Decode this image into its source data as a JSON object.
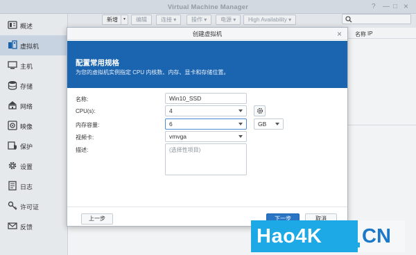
{
  "window": {
    "title": "Virtual Machine Manager",
    "help": "?",
    "minimize": "—",
    "maximize": "□",
    "close": "×"
  },
  "sidebar": {
    "active_index": 1,
    "items": [
      {
        "label": "概述",
        "icon": "overview-icon"
      },
      {
        "label": "虚拟机",
        "icon": "virtual-machine-icon"
      },
      {
        "label": "主机",
        "icon": "host-monitor-icon"
      },
      {
        "label": "存储",
        "icon": "storage-icon"
      },
      {
        "label": "网络",
        "icon": "network-icon"
      },
      {
        "label": "映像",
        "icon": "image-icon"
      },
      {
        "label": "保护",
        "icon": "protection-icon"
      },
      {
        "label": "设置",
        "icon": "settings-gear-icon"
      },
      {
        "label": "日志",
        "icon": "log-icon"
      },
      {
        "label": "许可证",
        "icon": "license-key-icon"
      },
      {
        "label": "反馈",
        "icon": "feedback-mail-icon"
      }
    ]
  },
  "toolbar": {
    "new_label": "新增",
    "edit_label": "编辑",
    "connect_label": "连接",
    "action_label": "操作",
    "power_label": "电源",
    "ha_label": "High Availability",
    "search_placeholder": ""
  },
  "table": {
    "col_name": "名称",
    "col_ip": "IP"
  },
  "dialog": {
    "title": "创建虚拟机",
    "close": "×",
    "heading": "配置常用规格",
    "subheading": "为您的虚拟机实例指定 CPU 内核数、内存、显卡和存储位置。",
    "fields": {
      "name_label": "名称:",
      "name_value": "Win10_SSD",
      "cpu_label": "CPU(s):",
      "cpu_value": "4",
      "memory_label": "内存容量:",
      "memory_value": "6",
      "memory_unit": "GB",
      "video_label": "视频卡:",
      "video_value": "vmvga",
      "desc_label": "描述:",
      "desc_placeholder": "(选择性项目)"
    },
    "buttons": {
      "prev": "上一步",
      "next": "下一步",
      "cancel": "取消"
    }
  },
  "watermark": {
    "part1": "Hao4K",
    "part2": "CN"
  },
  "colors": {
    "accent": "#1a64b0",
    "watermark_blue": "#1da9e6"
  }
}
